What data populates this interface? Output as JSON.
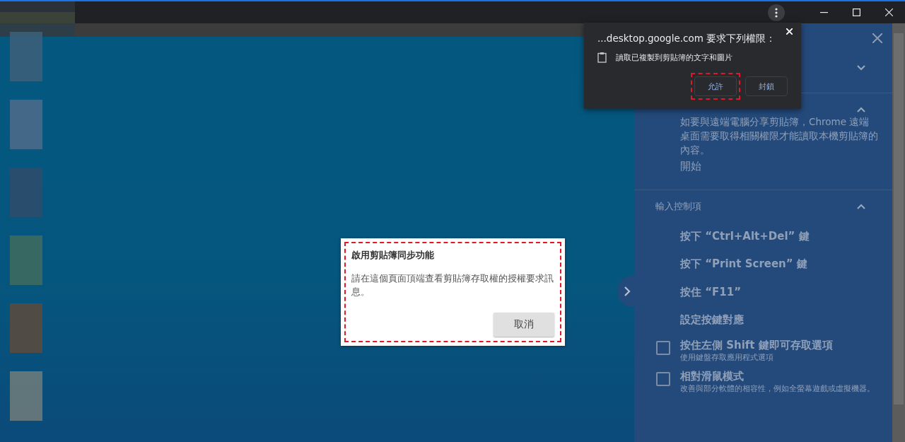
{
  "permission_popup": {
    "title": "...desktop.google.com 要求下列權限：",
    "permission": "讀取已複製到剪貼簿的文字和圖片",
    "buttons": [
      {
        "label": "允許",
        "highlighted": true
      },
      {
        "label": "封鎖",
        "highlighted": false
      }
    ]
  },
  "dialog": {
    "title": "啟用剪貼簿同步功能",
    "message": "請在這個頁面頂端查看剪貼簿存取權的授權要求訊息。",
    "button": "取消",
    "highlighted": true
  },
  "side_panel": {
    "sections": [
      {
        "expanded": false
      },
      {
        "kind": "clipboard",
        "expanded": true,
        "description": "如要與遠端電腦分享剪貼簿，Chrome 遠端桌面需要取得相關權限才能讀取本機剪貼簿的內容。",
        "action": "開始"
      },
      {
        "kind": "controls",
        "title": "輸入控制項",
        "expanded": true,
        "items": [
          "按下 “Ctrl+Alt+Del” 鍵",
          "按下 “Print Screen” 鍵",
          "按住 “F11”",
          "設定按鍵對應"
        ],
        "options": [
          {
            "label": "按住左側 Shift 鍵即可存取選項",
            "hint": "使用鍵盤存取應用程式選項",
            "checked": false
          },
          {
            "label": "相對滑鼠模式",
            "hint": "改善與部分軟體的相容性，例如全螢幕遊戲或虛擬機器。",
            "checked": false
          }
        ]
      }
    ]
  }
}
